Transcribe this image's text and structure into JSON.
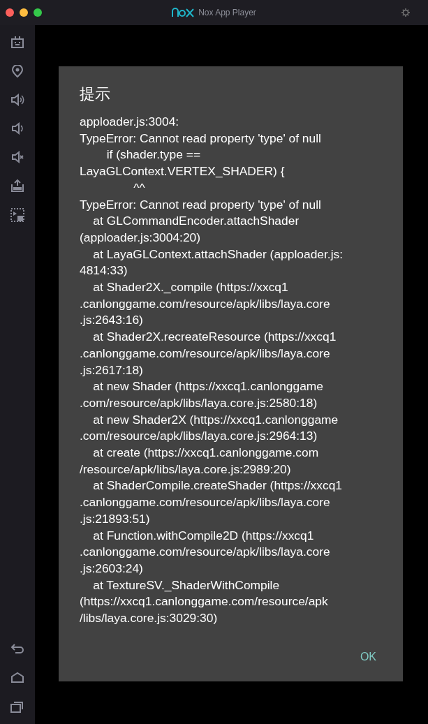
{
  "window": {
    "title": "Nox App Player"
  },
  "dialog": {
    "title": "提示",
    "message": "apploader.js:3004:\nTypeError: Cannot read property 'type' of null\n        if (shader.type ==\nLayaGLContext.VERTEX_SHADER) {\n                ^^\nTypeError: Cannot read property 'type' of null\n    at GLCommandEncoder.attachShader\n(apploader.js:3004:20)\n    at LayaGLContext.attachShader (apploader.js:\n4814:33)\n    at Shader2X._compile (https://xxcq1\n.canlonggame.com/resource/apk/libs/laya.core\n.js:2643:16)\n    at Shader2X.recreateResource (https://xxcq1\n.canlonggame.com/resource/apk/libs/laya.core\n.js:2617:18)\n    at new Shader (https://xxcq1.canlonggame\n.com/resource/apk/libs/laya.core.js:2580:18)\n    at new Shader2X (https://xxcq1.canlonggame\n.com/resource/apk/libs/laya.core.js:2964:13)\n    at create (https://xxcq1.canlonggame.com\n/resource/apk/libs/laya.core.js:2989:20)\n    at ShaderCompile.createShader (https://xxcq1\n.canlonggame.com/resource/apk/libs/laya.core\n.js:21893:51)\n    at Function.withCompile2D (https://xxcq1\n.canlonggame.com/resource/apk/libs/laya.core\n.js:2603:24)\n    at TextureSV._ShaderWithCompile\n(https://xxcq1.canlonggame.com/resource/apk\n/libs/laya.core.js:3029:30)",
    "buttons": [
      "OK"
    ]
  }
}
